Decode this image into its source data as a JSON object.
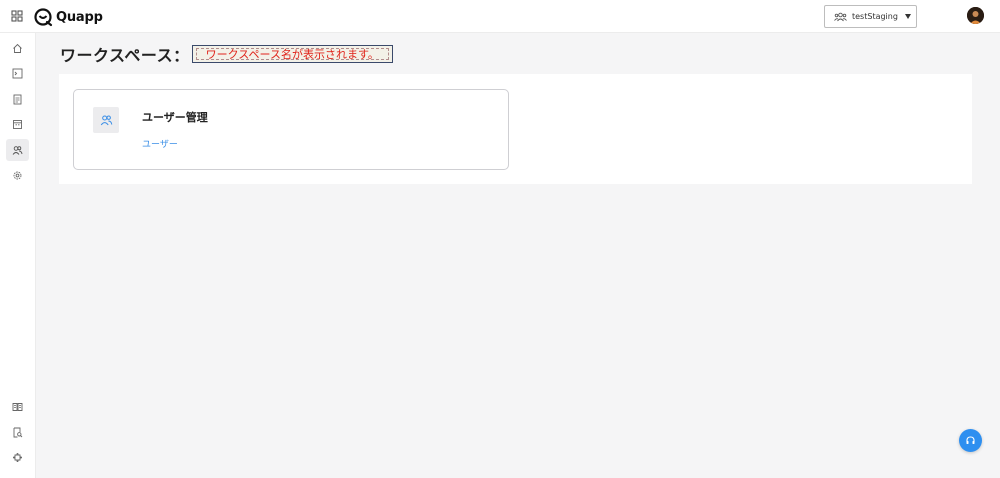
{
  "app": {
    "name": "Quapp"
  },
  "header": {
    "workspace_selector": {
      "value": "testStaging",
      "icon": "users-icon"
    }
  },
  "sidebar": {
    "items": [
      {
        "name": "home",
        "icon": "home-icon"
      },
      {
        "name": "console",
        "icon": "terminal-icon"
      },
      {
        "name": "documents",
        "icon": "document-icon"
      },
      {
        "name": "calendar",
        "icon": "calendar-icon"
      },
      {
        "name": "users",
        "icon": "users-icon",
        "active": true
      },
      {
        "name": "settings",
        "icon": "gear-icon"
      },
      {
        "name": "manual",
        "icon": "book-icon"
      },
      {
        "name": "search-doc",
        "icon": "doc-search-icon"
      },
      {
        "name": "plugins",
        "icon": "puzzle-icon"
      }
    ]
  },
  "main": {
    "title": "ワークスペース：",
    "workspace_name_placeholder": "ワークスペース名が表示されます。",
    "cards": [
      {
        "title": "ユーザー管理",
        "icon": "users-icon",
        "link": "ユーザー"
      }
    ]
  },
  "support_button": {
    "icon": "headset-icon"
  },
  "colors": {
    "accent": "#3a8ee6",
    "fab": "#2e8ff0",
    "placeholder_text": "#e0241b"
  }
}
